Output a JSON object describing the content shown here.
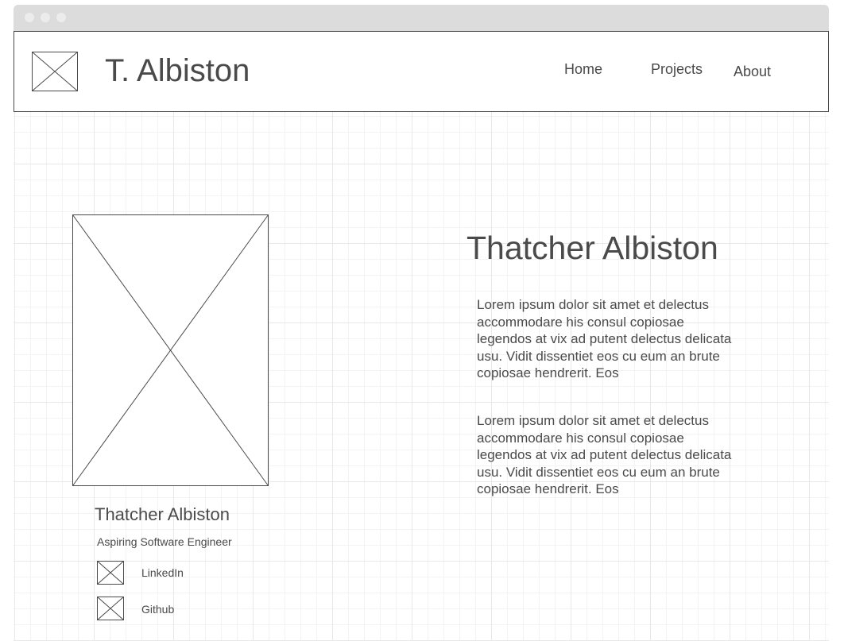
{
  "header": {
    "logo_icon": "image-placeholder-icon",
    "title": "T. Albiston",
    "nav": [
      {
        "label": "Home"
      },
      {
        "label": "Projects"
      },
      {
        "label": "About"
      }
    ]
  },
  "main": {
    "photo_icon": "image-placeholder-icon",
    "heading": "Thatcher Albiston",
    "paragraphs": [
      "Lorem ipsum dolor sit amet et delectus accommodare his consul copiosae legendos at vix ad putent delectus delicata usu. Vidit dissentiet eos cu eum an brute copiosae hendrerit. Eos",
      "Lorem ipsum dolor sit amet et delectus accommodare his consul copiosae legendos at vix ad putent delectus delicata usu. Vidit dissentiet eos cu eum an brute copiosae hendrerit. Eos"
    ]
  },
  "profile": {
    "name": "Thatcher Albiston",
    "role": "Aspiring Software Engineer",
    "links": [
      {
        "label": "LinkedIn",
        "icon": "image-placeholder-icon"
      },
      {
        "label": "Github",
        "icon": "image-placeholder-icon"
      }
    ]
  },
  "colors": {
    "text": "#4a4a4a",
    "titlebar": "#dcdcdc",
    "grid": "#e8e8e8"
  }
}
